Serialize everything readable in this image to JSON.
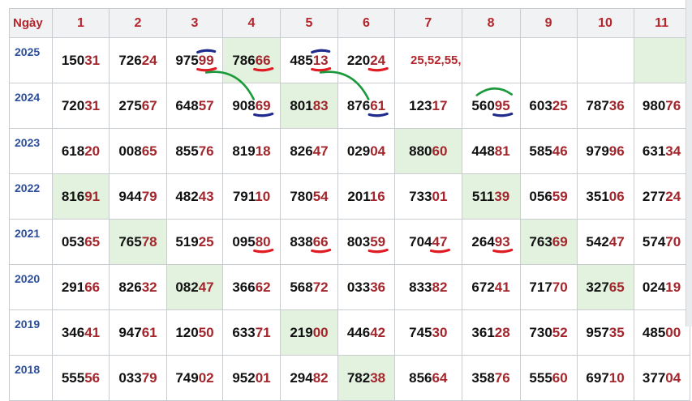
{
  "header": {
    "label": "Ngày",
    "columns": [
      "1",
      "2",
      "3",
      "4",
      "5",
      "6",
      "7",
      "8",
      "9",
      "10",
      "11"
    ]
  },
  "rows": [
    {
      "year": "2025",
      "cells": [
        {
          "p": "150",
          "s": "31"
        },
        {
          "p": "726",
          "s": "24"
        },
        {
          "p": "975",
          "s": "99"
        },
        {
          "p": "786",
          "s": "66",
          "hl": true
        },
        {
          "p": "485",
          "s": "13"
        },
        {
          "p": "220",
          "s": "24"
        },
        {
          "note": "25,52,55,"
        },
        {
          "p": "",
          "s": ""
        },
        {
          "p": "",
          "s": ""
        },
        {
          "p": "",
          "s": ""
        },
        {
          "p": "",
          "s": "",
          "hl": true
        }
      ]
    },
    {
      "year": "2024",
      "cells": [
        {
          "p": "720",
          "s": "31"
        },
        {
          "p": "275",
          "s": "67"
        },
        {
          "p": "648",
          "s": "57"
        },
        {
          "p": "908",
          "s": "69"
        },
        {
          "p": "801",
          "s": "83",
          "hl": true
        },
        {
          "p": "876",
          "s": "61"
        },
        {
          "p": "123",
          "s": "17"
        },
        {
          "p": "560",
          "s": "95"
        },
        {
          "p": "603",
          "s": "25"
        },
        {
          "p": "787",
          "s": "36"
        },
        {
          "p": "980",
          "s": "76"
        }
      ]
    },
    {
      "year": "2023",
      "cells": [
        {
          "p": "618",
          "s": "20"
        },
        {
          "p": "008",
          "s": "65"
        },
        {
          "p": "855",
          "s": "76"
        },
        {
          "p": "819",
          "s": "18"
        },
        {
          "p": "826",
          "s": "47"
        },
        {
          "p": "029",
          "s": "04"
        },
        {
          "p": "880",
          "s": "60",
          "hl": true
        },
        {
          "p": "448",
          "s": "81"
        },
        {
          "p": "585",
          "s": "46"
        },
        {
          "p": "979",
          "s": "96"
        },
        {
          "p": "631",
          "s": "34"
        }
      ]
    },
    {
      "year": "2022",
      "cells": [
        {
          "p": "816",
          "s": "91",
          "hl": true
        },
        {
          "p": "944",
          "s": "79"
        },
        {
          "p": "482",
          "s": "43"
        },
        {
          "p": "791",
          "s": "10"
        },
        {
          "p": "780",
          "s": "54"
        },
        {
          "p": "201",
          "s": "16"
        },
        {
          "p": "733",
          "s": "01"
        },
        {
          "p": "511",
          "s": "39",
          "hl": true
        },
        {
          "p": "056",
          "s": "59"
        },
        {
          "p": "351",
          "s": "06"
        },
        {
          "p": "277",
          "s": "24"
        }
      ]
    },
    {
      "year": "2021",
      "cells": [
        {
          "p": "053",
          "s": "65"
        },
        {
          "p": "765",
          "s": "78",
          "hl": true
        },
        {
          "p": "519",
          "s": "25"
        },
        {
          "p": "095",
          "s": "80"
        },
        {
          "p": "838",
          "s": "66"
        },
        {
          "p": "803",
          "s": "59"
        },
        {
          "p": "704",
          "s": "47"
        },
        {
          "p": "264",
          "s": "93"
        },
        {
          "p": "763",
          "s": "69",
          "hl": true
        },
        {
          "p": "542",
          "s": "47"
        },
        {
          "p": "574",
          "s": "70"
        }
      ]
    },
    {
      "year": "2020",
      "cells": [
        {
          "p": "291",
          "s": "66"
        },
        {
          "p": "826",
          "s": "32"
        },
        {
          "p": "082",
          "s": "47",
          "hl": true
        },
        {
          "p": "366",
          "s": "62"
        },
        {
          "p": "568",
          "s": "72"
        },
        {
          "p": "033",
          "s": "36"
        },
        {
          "p": "833",
          "s": "82"
        },
        {
          "p": "672",
          "s": "41"
        },
        {
          "p": "717",
          "s": "70"
        },
        {
          "p": "327",
          "s": "65",
          "hl": true
        },
        {
          "p": "024",
          "s": "19"
        }
      ]
    },
    {
      "year": "2019",
      "cells": [
        {
          "p": "346",
          "s": "41"
        },
        {
          "p": "947",
          "s": "61"
        },
        {
          "p": "120",
          "s": "50"
        },
        {
          "p": "633",
          "s": "71"
        },
        {
          "p": "219",
          "s": "00",
          "hl": true
        },
        {
          "p": "446",
          "s": "42"
        },
        {
          "p": "745",
          "s": "30"
        },
        {
          "p": "361",
          "s": "28"
        },
        {
          "p": "730",
          "s": "52"
        },
        {
          "p": "957",
          "s": "35"
        },
        {
          "p": "485",
          "s": "00"
        }
      ]
    },
    {
      "year": "2018",
      "cells": [
        {
          "p": "555",
          "s": "56"
        },
        {
          "p": "033",
          "s": "79"
        },
        {
          "p": "749",
          "s": "02"
        },
        {
          "p": "952",
          "s": "01"
        },
        {
          "p": "294",
          "s": "82"
        },
        {
          "p": "782",
          "s": "38",
          "hl": true
        },
        {
          "p": "856",
          "s": "64"
        },
        {
          "p": "358",
          "s": "76"
        },
        {
          "p": "555",
          "s": "60"
        },
        {
          "p": "697",
          "s": "10"
        },
        {
          "p": "377",
          "s": "04"
        }
      ]
    }
  ],
  "colors": {
    "header_bg": "#f1f2f4",
    "header_text": "#b3262c",
    "year_text": "#2e4f9c",
    "highlight_bg": "#e3f2df",
    "suffix_text": "#a3262c",
    "ink_red": "#e01b24",
    "ink_blue": "#1f2b8c",
    "ink_green": "#1a9a3a"
  }
}
